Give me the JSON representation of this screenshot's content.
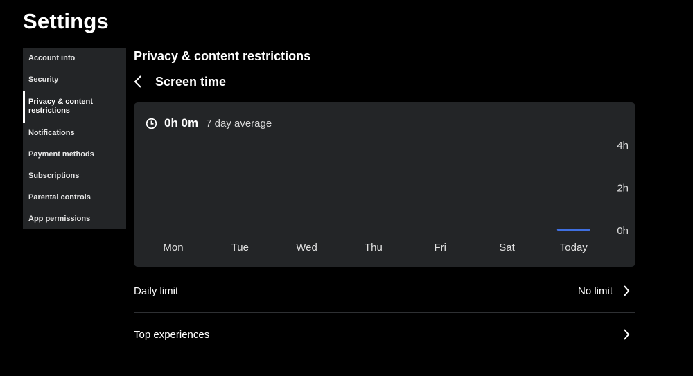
{
  "page": {
    "title": "Settings"
  },
  "sidebar": {
    "items": [
      {
        "label": "Account info",
        "active": false
      },
      {
        "label": "Security",
        "active": false
      },
      {
        "label": "Privacy & content restrictions",
        "active": true
      },
      {
        "label": "Notifications",
        "active": false
      },
      {
        "label": "Payment methods",
        "active": false
      },
      {
        "label": "Subscriptions",
        "active": false
      },
      {
        "label": "Parental controls",
        "active": false
      },
      {
        "label": "App permissions",
        "active": false
      }
    ]
  },
  "main": {
    "section_title": "Privacy & content restrictions",
    "subpage_title": "Screen time",
    "average": {
      "value": "0h 0m",
      "label": "7 day average"
    }
  },
  "chart_data": {
    "type": "bar",
    "categories": [
      "Mon",
      "Tue",
      "Wed",
      "Thu",
      "Fri",
      "Sat",
      "Today"
    ],
    "values": [
      0,
      0,
      0,
      0,
      0,
      0,
      0
    ],
    "y_ticks": [
      "0h",
      "2h",
      "4h"
    ],
    "ylim": [
      0,
      4
    ],
    "highlight_category": "Today",
    "bar_color": "#3f6fe0",
    "grid": false
  },
  "rows": [
    {
      "label": "Daily limit",
      "value": "No limit"
    },
    {
      "label": "Top experiences",
      "value": ""
    }
  ],
  "colors": {
    "background": "#000000",
    "card": "#232527",
    "accent": "#3f6fe0"
  }
}
